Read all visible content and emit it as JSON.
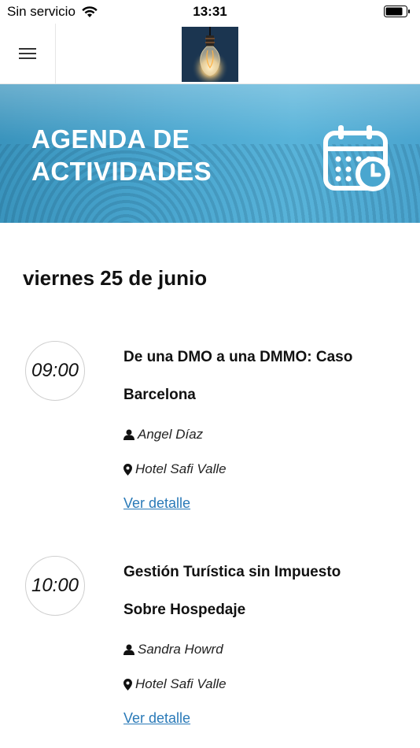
{
  "status_bar": {
    "carrier": "Sin servicio",
    "time": "13:31"
  },
  "banner": {
    "title_line1": "AGENDA DE",
    "title_line2": "ACTIVIDADES"
  },
  "day_heading": "viernes 25 de junio",
  "events": [
    {
      "time": "09:00",
      "title_line1": "De una DMO a una DMMO: Caso",
      "title_line2": "Barcelona",
      "speaker": "Angel Díaz",
      "location": "Hotel Safi Valle",
      "link": "Ver detalle"
    },
    {
      "time": "10:00",
      "title_line1": "Gestión Turística sin Impuesto",
      "title_line2": "Sobre Hospedaje",
      "speaker": "Sandra Howrd",
      "location": "Hotel Safi Valle",
      "link": "Ver detalle"
    }
  ],
  "colors": {
    "link": "#2a7ab8",
    "banner": "#4aa6cf"
  },
  "icons": [
    "wifi-icon",
    "battery-icon",
    "hamburger-menu-icon",
    "lightbulb-logo",
    "calendar-clock-icon",
    "person-icon",
    "map-marker-icon"
  ]
}
